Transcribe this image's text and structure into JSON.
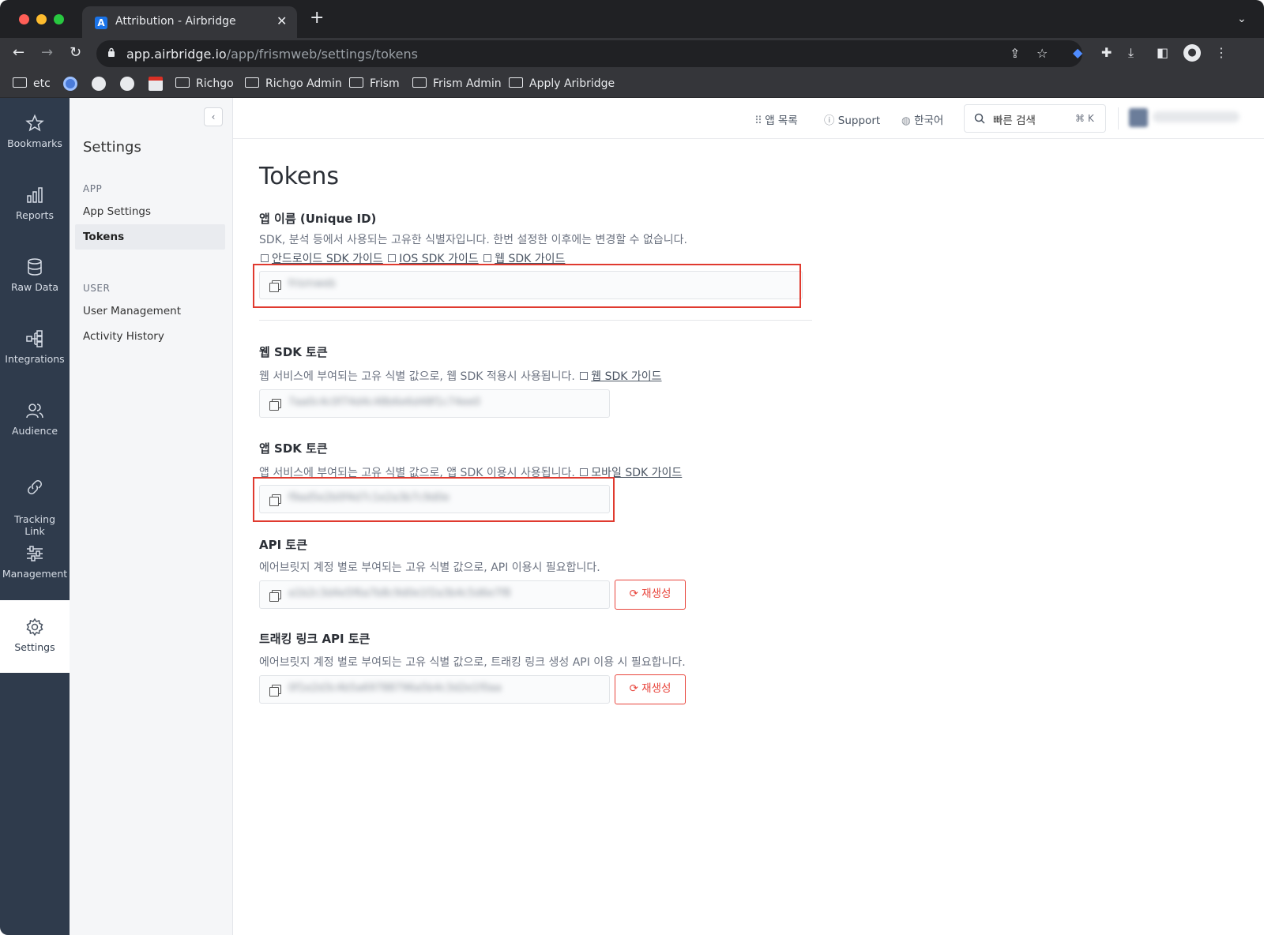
{
  "browser": {
    "tab_title": "Attribution - Airbridge",
    "tab_favicon": "A",
    "tab_close": "✕",
    "new_tab": "+",
    "url_host": "app.airbridge.io",
    "url_path": "/app/frismweb/settings/tokens",
    "bookmarks": [
      "etc",
      "Richgo",
      "Richgo Admin",
      "Frism",
      "Frism Admin",
      "Apply Aribridge"
    ]
  },
  "rail": {
    "items": [
      {
        "label": "Bookmarks",
        "icon": "star-icon"
      },
      {
        "label": "Reports",
        "icon": "bar-chart-icon"
      },
      {
        "label": "Raw Data",
        "icon": "database-icon"
      },
      {
        "label": "Integrations",
        "icon": "integrations-icon"
      },
      {
        "label": "Audience",
        "icon": "users-icon"
      },
      {
        "label": "Tracking\nLink",
        "icon": "link-icon"
      },
      {
        "label": "Management",
        "icon": "sliders-icon"
      },
      {
        "label": "Settings",
        "icon": "gear-icon"
      }
    ]
  },
  "sidebar": {
    "collapse": "‹",
    "title": "Settings",
    "app_section": "APP",
    "app_settings": "App Settings",
    "tokens": "Tokens",
    "user_section": "USER",
    "user_management": "User Management",
    "activity_history": "Activity History"
  },
  "topbar": {
    "app_list": "앱 목록",
    "support": "Support",
    "language": "한국어",
    "search_placeholder": "빠른 검색",
    "search_shortcut": "⌘ K"
  },
  "main": {
    "title": "Tokens",
    "app_name": {
      "title": "앱 이름 (Unique ID)",
      "desc": "SDK, 분석 등에서 사용되는 고유한 식별자입니다. 한번 설정한 이후에는 변경할 수 없습니다.",
      "link_android": "안드로이드 SDK 가이드",
      "link_ios": "IOS SDK 가이드",
      "link_web": "웹 SDK 가이드",
      "value": "frismweb"
    },
    "web_sdk": {
      "title": "웹 SDK 토큰",
      "desc": "웹 서비스에 부여되는 고유 식별 값으로, 웹 SDK 적용시 사용됩니다.",
      "link": "웹 SDK 가이드",
      "value": "7aa0c4c0f74d4c48b6e6d48f1c74ee0"
    },
    "app_sdk": {
      "title": "앱 SDK 토큰",
      "desc": "앱 서비스에 부여되는 고유 식별 값으로, 앱 SDK 이용시 사용됩니다.",
      "link": "모바일 SDK 가이드",
      "value": "f9ad5e2b0f4d7c1e2a3b7c9d0e"
    },
    "api": {
      "title": "API 토큰",
      "desc": "에어브릿지 계정 별로 부여되는 고유 식별 값으로, API 이용시 필요합니다.",
      "value": "a1b2c3d4e5f6a7b8c9d0e1f2a3b4c5d6e7f8",
      "regen": "재생성"
    },
    "tracking_api": {
      "title": "트래킹 링크 API 토큰",
      "desc": "에어브릿지 계정 별로 부여되는 고유 식별 값으로, 트래킹 링크 생성 API 이용 시 필요합니다.",
      "value": "0f1e2d3c4b5a69788796a5b4c3d2e1f0aa",
      "regen": "재생성"
    }
  }
}
